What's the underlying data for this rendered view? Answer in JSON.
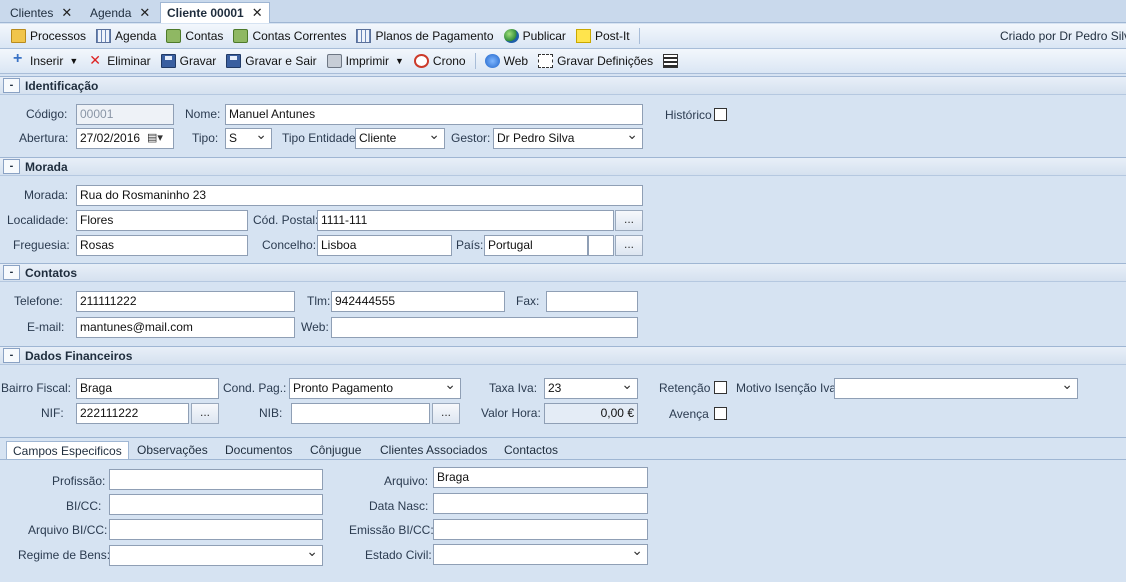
{
  "tabs": [
    {
      "label": "Clientes",
      "active": false
    },
    {
      "label": "Agenda",
      "active": false
    },
    {
      "label": "Cliente 00001",
      "active": true
    }
  ],
  "close_glyph": "✕",
  "toolbar1": {
    "items": [
      {
        "label": "Processos",
        "icon": "folder-icon"
      },
      {
        "label": "Agenda",
        "icon": "calendar-icon"
      },
      {
        "label": "Contas",
        "icon": "money-icon"
      },
      {
        "label": "Contas Correntes",
        "icon": "accounts-icon"
      },
      {
        "label": "Planos de Pagamento",
        "icon": "table-icon"
      },
      {
        "label": "Publicar",
        "icon": "globe-icon"
      },
      {
        "label": "Post-It",
        "icon": "note-icon"
      }
    ],
    "created_by": "Criado por Dr Pedro Silva"
  },
  "toolbar2": {
    "items": [
      {
        "label": "Inserir",
        "icon": "plus-icon"
      },
      {
        "label": "Eliminar",
        "icon": "delete-icon"
      },
      {
        "label": "Gravar",
        "icon": "save-icon"
      },
      {
        "label": "Gravar e Sair",
        "icon": "save-exit-icon"
      },
      {
        "label": "Imprimir",
        "icon": "printer-icon"
      },
      {
        "label": "Crono",
        "icon": "clock-icon"
      },
      {
        "label": "Web",
        "icon": "web-icon"
      },
      {
        "label": "Gravar Definições",
        "icon": "settings-icon"
      }
    ]
  },
  "sections": {
    "identificacao": "Identificação",
    "morada": "Morada",
    "contatos": "Contatos",
    "financeiros": "Dados Financeiros",
    "collapse_glyph": "-"
  },
  "ident": {
    "codigo_label": "Código:",
    "codigo": "00001",
    "nome_label": "Nome:",
    "nome": "Manuel Antunes",
    "historico_label": "Histórico",
    "abertura_label": "Abertura:",
    "abertura": "27/02/2016",
    "tipo_label": "Tipo:",
    "tipo": "S",
    "tipo_entidade_label": "Tipo Entidade:",
    "tipo_entidade": "Cliente",
    "gestor_label": "Gestor:",
    "gestor": "Dr Pedro Silva"
  },
  "morada": {
    "morada_label": "Morada:",
    "morada": "Rua do Rosmaninho 23",
    "localidade_label": "Localidade:",
    "localidade": "Flores",
    "cod_postal_label": "Cód. Postal:",
    "cod_postal": "1111-111",
    "freguesia_label": "Freguesia:",
    "freguesia": "Rosas",
    "concelho_label": "Concelho:",
    "concelho": "Lisboa",
    "pais_label": "País:",
    "pais": "Portugal",
    "ellipsis": "..."
  },
  "contatos": {
    "telefone_label": "Telefone:",
    "telefone": "211111222",
    "tlm_label": "Tlm:",
    "tlm": "942444555",
    "fax_label": "Fax:",
    "fax": "",
    "email_label": "E-mail:",
    "email": "mantunes@mail.com",
    "web_label": "Web:",
    "web": ""
  },
  "financeiros": {
    "bairro_fiscal_label": "Bairro Fiscal:",
    "bairro_fiscal": "Braga",
    "cond_pag_label": "Cond. Pag.:",
    "cond_pag": "Pronto Pagamento",
    "taxa_iva_label": "Taxa Iva:",
    "taxa_iva": "23",
    "retencao_label": "Retenção",
    "motivo_label": "Motivo Isenção Iva:",
    "motivo": "",
    "nif_label": "NIF:",
    "nif": "222111222",
    "nib_label": "NIB:",
    "nib": "",
    "valor_hora_label": "Valor Hora:",
    "valor_hora": "0,00 €",
    "avenca_label": "Avença"
  },
  "subtabs": [
    {
      "label": "Campos Especificos",
      "active": true
    },
    {
      "label": "Observações",
      "active": false
    },
    {
      "label": "Documentos",
      "active": false
    },
    {
      "label": "Cônjugue",
      "active": false
    },
    {
      "label": "Clientes Associados",
      "active": false
    },
    {
      "label": "Contactos",
      "active": false
    }
  ],
  "especificos": {
    "profissao_label": "Profissão:",
    "profissao": "",
    "bicc_label": "BI/CC:",
    "bicc": "",
    "arquivo_bicc_label": "Arquivo BI/CC:",
    "arquivo_bicc": "",
    "regime_label": "Regime de Bens:",
    "regime": "",
    "arquivo_label": "Arquivo:",
    "arquivo": "Braga",
    "data_nasc_label": "Data Nasc:",
    "data_nasc": "",
    "emissao_label": "Emissão BI/CC:",
    "emissao": "",
    "estado_civil_label": "Estado Civil:",
    "estado_civil": ""
  }
}
